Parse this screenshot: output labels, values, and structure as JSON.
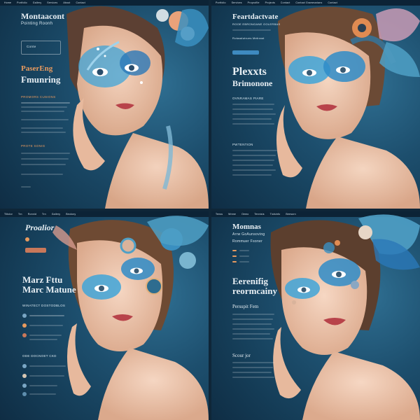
{
  "panels": [
    {
      "nav": [
        "Home",
        "Portfolio",
        "Gallery",
        "Services",
        "About",
        "Contact"
      ],
      "title": "Montaacont",
      "subtitle": "Pointing Roonh",
      "field_label": "Conte",
      "heading_accent": "PaserEng",
      "heading_main": "Fmunring",
      "section1": "PROMORS CUSIONS",
      "section2": "PROTE SONIG"
    },
    {
      "nav": [
        "Portfolio",
        "Services",
        "Proprofile",
        "Projects",
        "Contact",
        "Contact Grammarians",
        "Contact"
      ],
      "title": "Feartdactvate",
      "subtitle": "ROOE EBRONGANE OOLERBAS",
      "caption": "Rotaadutrues Mebrast",
      "heading_main1": "Plexxts",
      "heading_main2": "Brimonone",
      "section1": "OVNRAMAS PIARE",
      "section2": "PWTENTION"
    },
    {
      "nav": [
        "Tiitolor",
        "Trn",
        "Ronnid",
        "Trn",
        "Gallery",
        "Beolony"
      ],
      "title": "Proalior",
      "heading_main1": "Marz Fttu",
      "heading_main2": "Marc Matune",
      "section1": "WINATECT DOSTODBLOS",
      "section2": "ODE DOCNOET CKD"
    },
    {
      "nav": [
        "Tenss",
        "Wnme",
        "Oemo",
        "Tennisis",
        "Tiolsinfo",
        "Beesorn"
      ],
      "title": "Momnas",
      "subtitle": "Arrw GoAunsoving",
      "caption": "Rommuer Fsoner",
      "heading_main1": "Eerenifig",
      "heading_main2": "reormcainy",
      "section1": "Persupit Fem",
      "section2": "Scour jor"
    }
  ],
  "colors": {
    "bg": "#1a4a68",
    "accent_orange": "#e79a5f",
    "eyeshadow": "#3fa4d8",
    "lips": "#b8434a"
  }
}
